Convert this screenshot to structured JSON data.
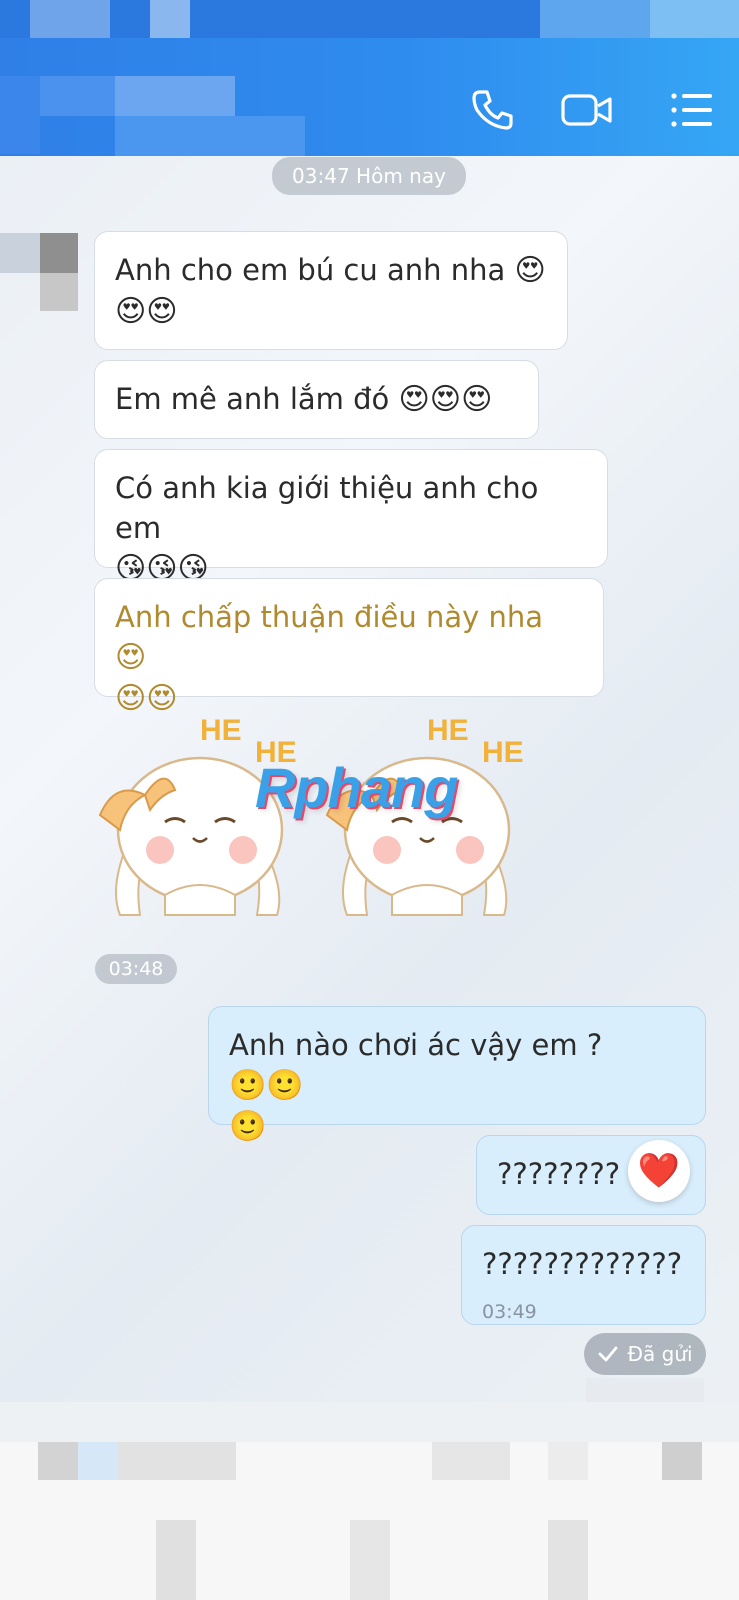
{
  "header": {
    "icons": [
      "phone-icon",
      "video-call-icon",
      "menu-icon"
    ],
    "color": "#2f8cef"
  },
  "chat": {
    "date_separator": "03:47 Hôm nay",
    "incoming": [
      {
        "text": "Anh cho em bú cu anh nha",
        "emoji": "😍😍😍"
      },
      {
        "text": "Em mê anh lắm đó",
        "emoji": "😍😍😍"
      },
      {
        "text": "Có anh kia giới thiệu anh cho em",
        "emoji": "😘😘😘"
      },
      {
        "text": "Anh chấp thuận điều này nha",
        "emoji": "😍😍😍"
      }
    ],
    "sticker": {
      "caption1": "HE",
      "caption2": "HE"
    },
    "watermark": "Rphang",
    "incoming_time": "03:48",
    "outgoing": [
      {
        "text": "Anh nào chơi ác vậy em ?",
        "emoji": "🙂🙂🙂"
      },
      {
        "text": "????????",
        "reaction": "❤️"
      },
      {
        "text": "?????????????",
        "time": "03:49"
      }
    ],
    "status": "Đã gửi"
  }
}
